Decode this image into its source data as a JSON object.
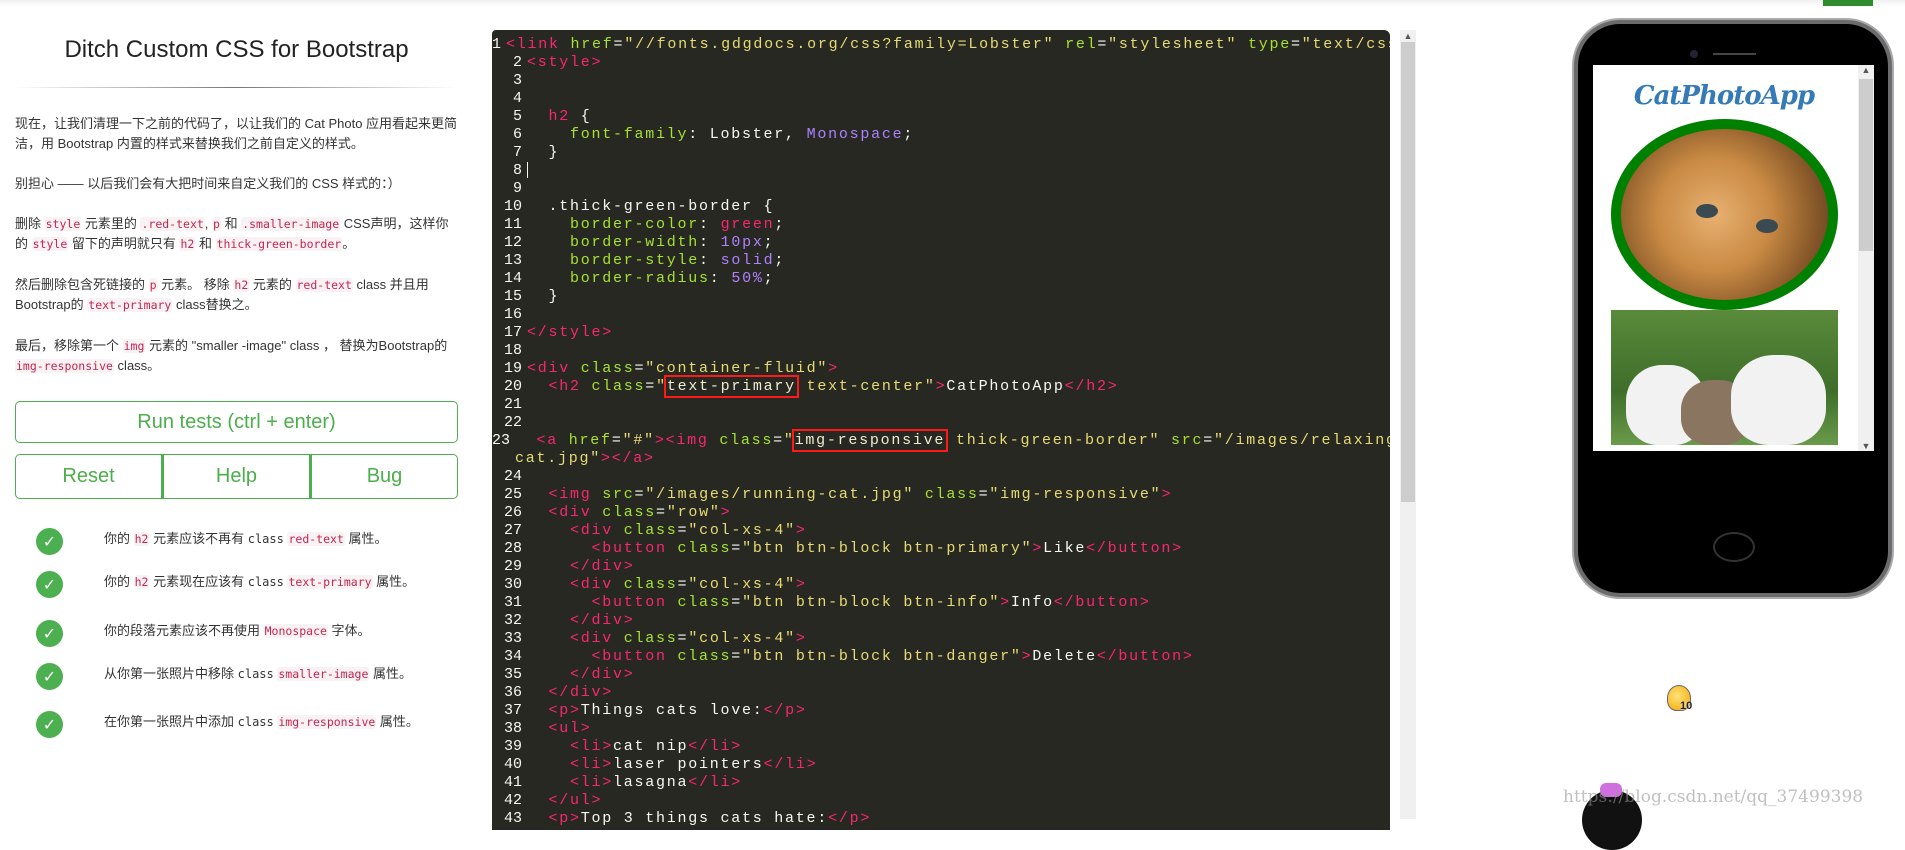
{
  "lesson": {
    "title": "Ditch Custom CSS for Bootstrap",
    "paragraphs": [
      [
        {
          "t": "现在，让我们清理一下之前的代码了，以让我们的 Cat Photo 应用看起来更简洁，用 Bootstrap 内置的样式来替换我们之前自定义的样式。"
        }
      ],
      [
        {
          "t": "别担心 —— 以后我们会有大把时间来自定义我们的 CSS 样式的：）"
        }
      ],
      [
        {
          "t": "删除 "
        },
        {
          "c": "style"
        },
        {
          "t": " 元素里的 "
        },
        {
          "c": ".red-text"
        },
        {
          "t": ", "
        },
        {
          "c": "p"
        },
        {
          "t": " 和 "
        },
        {
          "c": ".smaller-image"
        },
        {
          "t": " CSS声明，这样你的 "
        },
        {
          "c": "style"
        },
        {
          "t": " 留下的声明就只有 "
        },
        {
          "c": "h2"
        },
        {
          "t": " 和 "
        },
        {
          "c": "thick-green-border"
        },
        {
          "t": "。"
        }
      ],
      [
        {
          "t": "然后删除包含死链接的 "
        },
        {
          "c": "p"
        },
        {
          "t": " 元素。 移除 "
        },
        {
          "c": "h2"
        },
        {
          "t": " 元素的 "
        },
        {
          "c": "red-text"
        },
        {
          "t": " class 并且用Bootstrap的 "
        },
        {
          "c": "text-primary"
        },
        {
          "t": " class替换之。"
        }
      ],
      [
        {
          "t": "最后，移除第一个 "
        },
        {
          "c": "img"
        },
        {
          "t": " 元素的 \"smaller -image\" class ， 替换为Bootstrap的 "
        },
        {
          "c": "img-responsive"
        },
        {
          "t": " class。"
        }
      ]
    ],
    "run_button": "Run tests (ctrl + enter)",
    "reset_button": "Reset",
    "help_button": "Help",
    "bug_button": "Bug",
    "tests": [
      [
        {
          "t": "你的 "
        },
        {
          "c": "h2"
        },
        {
          "t": " 元素应该不再有 "
        },
        {
          "m": "class"
        },
        {
          "t": " "
        },
        {
          "c": "red-text"
        },
        {
          "t": " 属性。"
        }
      ],
      [
        {
          "t": "你的 "
        },
        {
          "c": "h2"
        },
        {
          "t": " 元素现在应该有 "
        },
        {
          "m": "class"
        },
        {
          "t": " "
        },
        {
          "c": "text-primary"
        },
        {
          "t": " 属性。"
        }
      ],
      [
        {
          "t": "你的段落元素应该不再使用 "
        },
        {
          "c": "Monospace"
        },
        {
          "t": " 字体。"
        }
      ],
      [
        {
          "t": "从你第一张照片中移除 "
        },
        {
          "m": "class"
        },
        {
          "t": " "
        },
        {
          "c": "smaller-image"
        },
        {
          "t": " 属性。"
        }
      ],
      [
        {
          "t": "在你第一张照片中添加 "
        },
        {
          "m": "class"
        },
        {
          "t": " "
        },
        {
          "c": "img-responsive"
        },
        {
          "t": " 属性。"
        }
      ]
    ],
    "test_status_icon": "check-circle-icon",
    "accent_color": "#4cae4c"
  },
  "editor": {
    "lines": [
      [
        [
          "t",
          "<link "
        ],
        [
          "a",
          "href"
        ],
        [
          "p",
          "="
        ],
        [
          "s",
          "\"//fonts.gdgdocs.org/css?family=Lobster\""
        ],
        [
          "p",
          " "
        ],
        [
          "a",
          "rel"
        ],
        [
          "p",
          "="
        ],
        [
          "s",
          "\"stylesheet\""
        ],
        [
          "p",
          " "
        ],
        [
          "a",
          "type"
        ],
        [
          "p",
          "="
        ],
        [
          "s",
          "\"text/css\""
        ],
        [
          "t",
          ">"
        ]
      ],
      [
        [
          "t",
          "<style>"
        ]
      ],
      [],
      [],
      [
        [
          "p",
          "  "
        ],
        [
          "t",
          "h2"
        ],
        [
          "p",
          " {"
        ]
      ],
      [
        [
          "p",
          "    "
        ],
        [
          "a",
          "font-family"
        ],
        [
          "p",
          ": Lobster, "
        ],
        [
          "n",
          "Monospace"
        ],
        [
          "p",
          ";"
        ]
      ],
      [
        [
          "p",
          "  }"
        ]
      ],
      [
        [
          "cursor",
          ""
        ]
      ],
      [],
      [
        [
          "p",
          "  .thick-green-border {"
        ]
      ],
      [
        [
          "p",
          "    "
        ],
        [
          "a",
          "border-color"
        ],
        [
          "p",
          ": "
        ],
        [
          "t",
          "green"
        ],
        [
          "p",
          ";"
        ]
      ],
      [
        [
          "p",
          "    "
        ],
        [
          "a",
          "border-width"
        ],
        [
          "p",
          ": "
        ],
        [
          "n",
          "10px"
        ],
        [
          "p",
          ";"
        ]
      ],
      [
        [
          "p",
          "    "
        ],
        [
          "a",
          "border-style"
        ],
        [
          "p",
          ": "
        ],
        [
          "n",
          "solid"
        ],
        [
          "p",
          ";"
        ]
      ],
      [
        [
          "p",
          "    "
        ],
        [
          "a",
          "border-radius"
        ],
        [
          "p",
          ": "
        ],
        [
          "n",
          "50%"
        ],
        [
          "p",
          ";"
        ]
      ],
      [
        [
          "p",
          "  }"
        ]
      ],
      [],
      [
        [
          "t",
          "</style>"
        ]
      ],
      [],
      [
        [
          "t",
          "<div "
        ],
        [
          "a",
          "class"
        ],
        [
          "p",
          "="
        ],
        [
          "s",
          "\"container-fluid\""
        ],
        [
          "t",
          ">"
        ]
      ],
      [
        [
          "p",
          "  "
        ],
        [
          "t",
          "<h2 "
        ],
        [
          "a",
          "class"
        ],
        [
          "p",
          "="
        ],
        [
          "s",
          "\""
        ],
        [
          "sb",
          "text-primary"
        ],
        [
          "s",
          " text-center\""
        ],
        [
          "t",
          ">"
        ],
        [
          "p",
          "CatPhotoApp"
        ],
        [
          "t",
          "</h2>"
        ]
      ],
      [],
      [],
      [
        [
          "p",
          "  "
        ],
        [
          "t",
          "<a "
        ],
        [
          "a",
          "href"
        ],
        [
          "p",
          "="
        ],
        [
          "s",
          "\"#\""
        ],
        [
          "t",
          "><img "
        ],
        [
          "a",
          "class"
        ],
        [
          "p",
          "="
        ],
        [
          "s",
          "\""
        ],
        [
          "sb",
          "img-responsive"
        ],
        [
          "s",
          " thick-green-border\""
        ],
        [
          "p",
          " "
        ],
        [
          "a",
          "src"
        ],
        [
          "p",
          "="
        ],
        [
          "s",
          "\"/images/relaxing-"
        ],
        [
          "br",
          ""
        ],
        [
          "s",
          "cat.jpg\""
        ],
        [
          "t",
          "></a>"
        ]
      ],
      [],
      [
        [
          "p",
          "  "
        ],
        [
          "t",
          "<img "
        ],
        [
          "a",
          "src"
        ],
        [
          "p",
          "="
        ],
        [
          "s",
          "\"/images/running-cat.jpg\""
        ],
        [
          "p",
          " "
        ],
        [
          "a",
          "class"
        ],
        [
          "p",
          "="
        ],
        [
          "s",
          "\"img-responsive\""
        ],
        [
          "t",
          ">"
        ]
      ],
      [
        [
          "p",
          "  "
        ],
        [
          "t",
          "<div "
        ],
        [
          "a",
          "class"
        ],
        [
          "p",
          "="
        ],
        [
          "s",
          "\"row\""
        ],
        [
          "t",
          ">"
        ]
      ],
      [
        [
          "p",
          "    "
        ],
        [
          "t",
          "<div "
        ],
        [
          "a",
          "class"
        ],
        [
          "p",
          "="
        ],
        [
          "s",
          "\"col-xs-4\""
        ],
        [
          "t",
          ">"
        ]
      ],
      [
        [
          "p",
          "      "
        ],
        [
          "t",
          "<button "
        ],
        [
          "a",
          "class"
        ],
        [
          "p",
          "="
        ],
        [
          "s",
          "\"btn btn-block btn-primary\""
        ],
        [
          "t",
          ">"
        ],
        [
          "p",
          "Like"
        ],
        [
          "t",
          "</button>"
        ]
      ],
      [
        [
          "p",
          "    "
        ],
        [
          "t",
          "</div>"
        ]
      ],
      [
        [
          "p",
          "    "
        ],
        [
          "t",
          "<div "
        ],
        [
          "a",
          "class"
        ],
        [
          "p",
          "="
        ],
        [
          "s",
          "\"col-xs-4\""
        ],
        [
          "t",
          ">"
        ]
      ],
      [
        [
          "p",
          "      "
        ],
        [
          "t",
          "<button "
        ],
        [
          "a",
          "class"
        ],
        [
          "p",
          "="
        ],
        [
          "s",
          "\"btn btn-block btn-info\""
        ],
        [
          "t",
          ">"
        ],
        [
          "p",
          "Info"
        ],
        [
          "t",
          "</button>"
        ]
      ],
      [
        [
          "p",
          "    "
        ],
        [
          "t",
          "</div>"
        ]
      ],
      [
        [
          "p",
          "    "
        ],
        [
          "t",
          "<div "
        ],
        [
          "a",
          "class"
        ],
        [
          "p",
          "="
        ],
        [
          "s",
          "\"col-xs-4\""
        ],
        [
          "t",
          ">"
        ]
      ],
      [
        [
          "p",
          "      "
        ],
        [
          "t",
          "<button "
        ],
        [
          "a",
          "class"
        ],
        [
          "p",
          "="
        ],
        [
          "s",
          "\"btn btn-block btn-danger\""
        ],
        [
          "t",
          ">"
        ],
        [
          "p",
          "Delete"
        ],
        [
          "t",
          "</button>"
        ]
      ],
      [
        [
          "p",
          "    "
        ],
        [
          "t",
          "</div>"
        ]
      ],
      [
        [
          "p",
          "  "
        ],
        [
          "t",
          "</div>"
        ]
      ],
      [
        [
          "p",
          "  "
        ],
        [
          "t",
          "<p>"
        ],
        [
          "p",
          "Things cats love:"
        ],
        [
          "t",
          "</p>"
        ]
      ],
      [
        [
          "p",
          "  "
        ],
        [
          "t",
          "<ul>"
        ]
      ],
      [
        [
          "p",
          "    "
        ],
        [
          "t",
          "<li>"
        ],
        [
          "p",
          "cat nip"
        ],
        [
          "t",
          "</li>"
        ]
      ],
      [
        [
          "p",
          "    "
        ],
        [
          "t",
          "<li>"
        ],
        [
          "p",
          "laser pointers"
        ],
        [
          "t",
          "</li>"
        ]
      ],
      [
        [
          "p",
          "    "
        ],
        [
          "t",
          "<li>"
        ],
        [
          "p",
          "lasagna"
        ],
        [
          "t",
          "</li>"
        ]
      ],
      [
        [
          "p",
          "  "
        ],
        [
          "t",
          "</ul>"
        ]
      ],
      [
        [
          "p",
          "  "
        ],
        [
          "t",
          "<p>"
        ],
        [
          "p",
          "Top 3 things cats hate:"
        ],
        [
          "t",
          "</p>"
        ]
      ]
    ],
    "colors": {
      "background": "#272822",
      "tag": "#f92672",
      "attr": "#a6e22e",
      "string": "#e6db74",
      "number": "#ae81ff",
      "highlight_box": "#ff1a1a"
    }
  },
  "preview": {
    "app_title": "CatPhotoApp",
    "title_color": "#337ab7",
    "image_border_color": "#008000"
  },
  "hint": {
    "icon": "lightbulb-icon",
    "count": "10"
  },
  "watermark": "https://blog.csdn.net/qq_37499398"
}
